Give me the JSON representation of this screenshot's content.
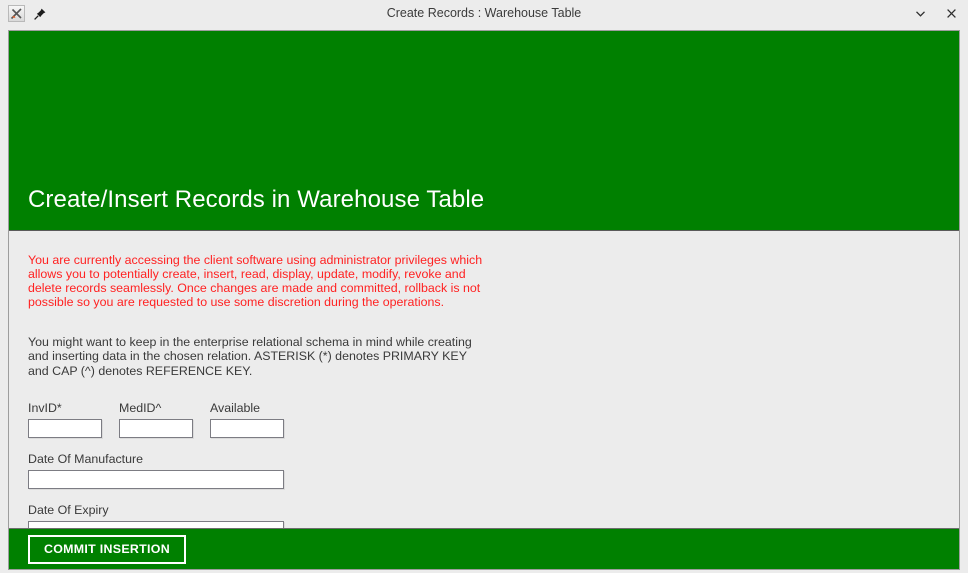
{
  "titlebar": {
    "app_icon": "tk-app-icon",
    "pin_icon": "pin-icon",
    "title": "Create Records : Warehouse Table",
    "minimize_label": "⌄",
    "close_label": "✕"
  },
  "header": {
    "title": "Create/Insert Records in Warehouse Table",
    "bg_color": "#008000"
  },
  "content": {
    "warning_text": "You are currently accessing the client software using administrator privileges which allows you to potentially create, insert, read, display, update, modify, revoke and delete records seamlessly. Once changes are made and committed, rollback is not possible so you are requested to use some discretion during the operations.",
    "warning_color": "#ff2222",
    "info_text": "You might want to keep in the enterprise relational schema in mind while creating and inserting data in the chosen relation. ASTERISK (*) denotes PRIMARY KEY and CAP (^) denotes REFERENCE KEY.",
    "fields": [
      {
        "label": "InvID*",
        "value": "",
        "placeholder": ""
      },
      {
        "label": "MedID^",
        "value": "",
        "placeholder": ""
      },
      {
        "label": "Available",
        "value": "",
        "placeholder": ""
      },
      {
        "label": "Date Of Manufacture",
        "value": "",
        "placeholder": ""
      },
      {
        "label": "Date Of Expiry",
        "value": "",
        "placeholder": ""
      }
    ]
  },
  "footer": {
    "commit_label": "COMMIT INSERTION",
    "bg_color": "#008000"
  }
}
